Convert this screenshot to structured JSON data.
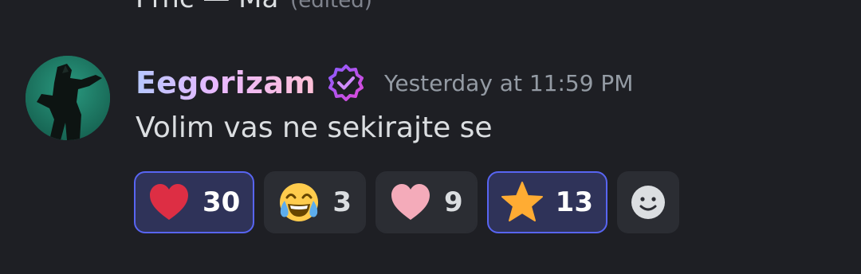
{
  "previous_message": {
    "text": "Prnc — Ma",
    "edited_label": "(edited)"
  },
  "message": {
    "username": "Eegorizam",
    "timestamp": "Yesterday at 11:59 PM",
    "content": "Volim vas ne sekirajte se",
    "avatar": "avatar-figure-on-teal",
    "badge_icon": "verified-check-icon",
    "colors": {
      "username_gradient": [
        "#b6c8ff",
        "#e9b8ff",
        "#ffc0d6"
      ],
      "reaction_active_border": "#5865f2",
      "reaction_active_bg": "#2f3359"
    }
  },
  "reactions": [
    {
      "emoji": "red-heart-icon",
      "count": "30",
      "active": true
    },
    {
      "emoji": "tears-of-joy-icon",
      "count": "3",
      "active": false
    },
    {
      "emoji": "pink-heart-icon",
      "count": "9",
      "active": false
    },
    {
      "emoji": "star-icon",
      "count": "13",
      "active": true
    }
  ],
  "add_reaction_icon": "add-reaction-smiley-icon"
}
